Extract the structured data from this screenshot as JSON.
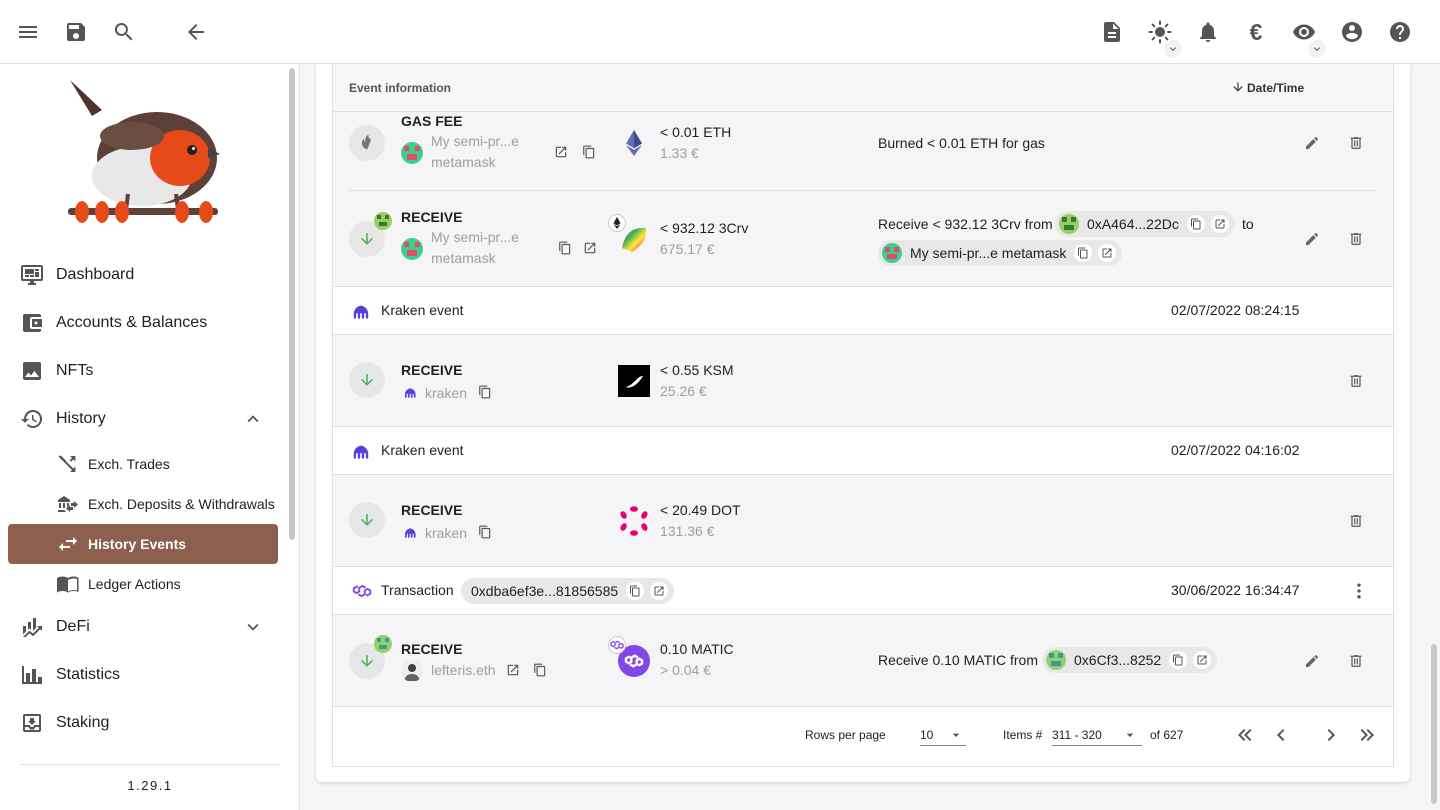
{
  "sidebar": {
    "items": [
      {
        "label": "Dashboard",
        "icon": "monitor-dashboard-icon"
      },
      {
        "label": "Accounts & Balances",
        "icon": "wallet-icon"
      },
      {
        "label": "NFTs",
        "icon": "image-icon"
      },
      {
        "label": "History",
        "icon": "history-icon"
      },
      {
        "label": "Exch. Trades",
        "icon": "shuffle-icon"
      },
      {
        "label": "Exch. Deposits & Withdrawals",
        "icon": "bank-transfer-icon"
      },
      {
        "label": "History Events",
        "icon": "swap-horizontal-icon",
        "active": true
      },
      {
        "label": "Ledger Actions",
        "icon": "book-open-icon"
      },
      {
        "label": "DeFi",
        "icon": "finance-icon"
      },
      {
        "label": "Statistics",
        "icon": "chart-bar-icon"
      },
      {
        "label": "Staking",
        "icon": "inbox-download-icon"
      }
    ],
    "version": "1.29.1"
  },
  "topbar": {
    "currency_symbol": "€"
  },
  "table": {
    "header": {
      "event_info": "Event information",
      "date_time": "Date/Time"
    },
    "rows": [
      {
        "type": "GAS FEE",
        "account_line1": "My semi-pr...e",
        "account_line2": "metamask",
        "amount": "< 0.01 ETH",
        "fiat": "1.33 €",
        "description": "Burned < 0.01 ETH for gas"
      },
      {
        "type": "RECEIVE",
        "account_line1": "My semi-pr...e",
        "account_line2": "metamask",
        "amount": "< 932.12 3Crv",
        "fiat": "675.17 €",
        "desc_prefix": "Receive < 932.12 3Crv from",
        "from_chip": "0xA464...22Dc",
        "desc_to": "to",
        "to_chip": "My semi-pr...e metamask"
      }
    ],
    "groups": [
      {
        "label": "Kraken event",
        "date": "02/07/2022 08:24:15",
        "event": {
          "type": "RECEIVE",
          "account": "kraken",
          "amount": "< 0.55 KSM",
          "fiat": "25.26 €"
        }
      },
      {
        "label": "Kraken event",
        "date": "02/07/2022 04:16:02",
        "event": {
          "type": "RECEIVE",
          "account": "kraken",
          "amount": "< 20.49 DOT",
          "fiat": "131.36 €"
        }
      },
      {
        "label": "Transaction",
        "tx_chip": "0xdba6ef3e...81856585",
        "date": "30/06/2022 16:34:47",
        "event": {
          "type": "RECEIVE",
          "account": "lefteris.eth",
          "amount": "0.10 MATIC",
          "fiat": "> 0.04 €",
          "desc_prefix": "Receive 0.10 MATIC from",
          "from_chip": "0x6Cf3...8252"
        }
      }
    ]
  },
  "pagination": {
    "rows_per_page_label": "Rows per page",
    "rows_per_page": "10",
    "items_label": "Items #",
    "items_range": "311 - 320",
    "of_total": "of 627"
  }
}
